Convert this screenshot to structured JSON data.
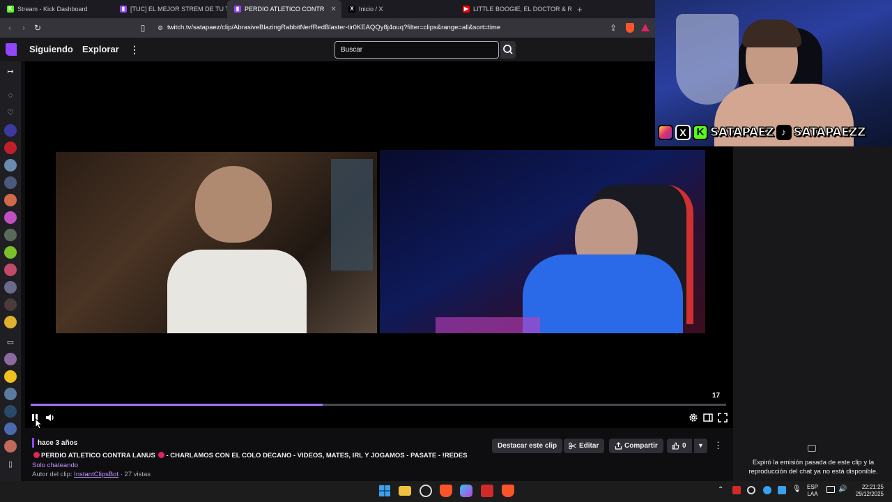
{
  "browser": {
    "tabs": [
      {
        "label": "Stream - Kick Dashboard",
        "favicon": "kick-icon",
        "color": "#53fc18"
      },
      {
        "label": "[TUC] EL MEJOR STREM DE TU TARDE",
        "favicon": "twitch-icon",
        "color": "#9147ff"
      },
      {
        "label": "PERDIO ATLETICO CONTR",
        "favicon": "twitch-icon",
        "color": "#9147ff",
        "active": true
      },
      {
        "label": "Inicio / X",
        "favicon": "x-icon",
        "color": "#000000"
      },
      {
        "label": "LITTLE BOOGIE, EL DOCTOR & RUSH",
        "favicon": "youtube-icon",
        "color": "#ff0000"
      }
    ],
    "new_tab": "+",
    "url": "twitch.tv/satapaez/clip/AbrasiveBlazingRabbitNerfRedBlaster-tir0KEAQQy8j4ouq?filter=clips&range=all&sort=time"
  },
  "twitch_nav": {
    "following": "Siguiendo",
    "browse": "Explorar",
    "search_placeholder": "Buscar"
  },
  "player": {
    "progress_fraction": 0.42,
    "time_remaining": "17"
  },
  "clip_info": {
    "ago": "hace 3 años",
    "title_part1": "PERDIO ATLETICO CONTRA LANUS",
    "title_part2": "- CHARLAMOS CON EL COLO DECANO - VIDEOS, MATES, IRL Y JOGAMOS - PASATE - !REDES",
    "category": "Solo chateando",
    "author_prefix": "Autor del clip:",
    "author": "InstantClipsBot",
    "views": "· 27 vistas"
  },
  "actions": {
    "feature": "Destacar este clip",
    "edit": "Editar",
    "share": "Compartir",
    "likes": "0"
  },
  "chat_panel": {
    "message": "Expiró la emisión pasada de este clip y la reproducción del chat ya no está disponible."
  },
  "overlay": {
    "handle1": "SATAPAEZ",
    "handle2": "SATAPAEZZ"
  },
  "taskbar": {
    "lang1": "ESP",
    "lang2": "LAA",
    "time": "22:21:25",
    "date": "29/12/2025"
  }
}
